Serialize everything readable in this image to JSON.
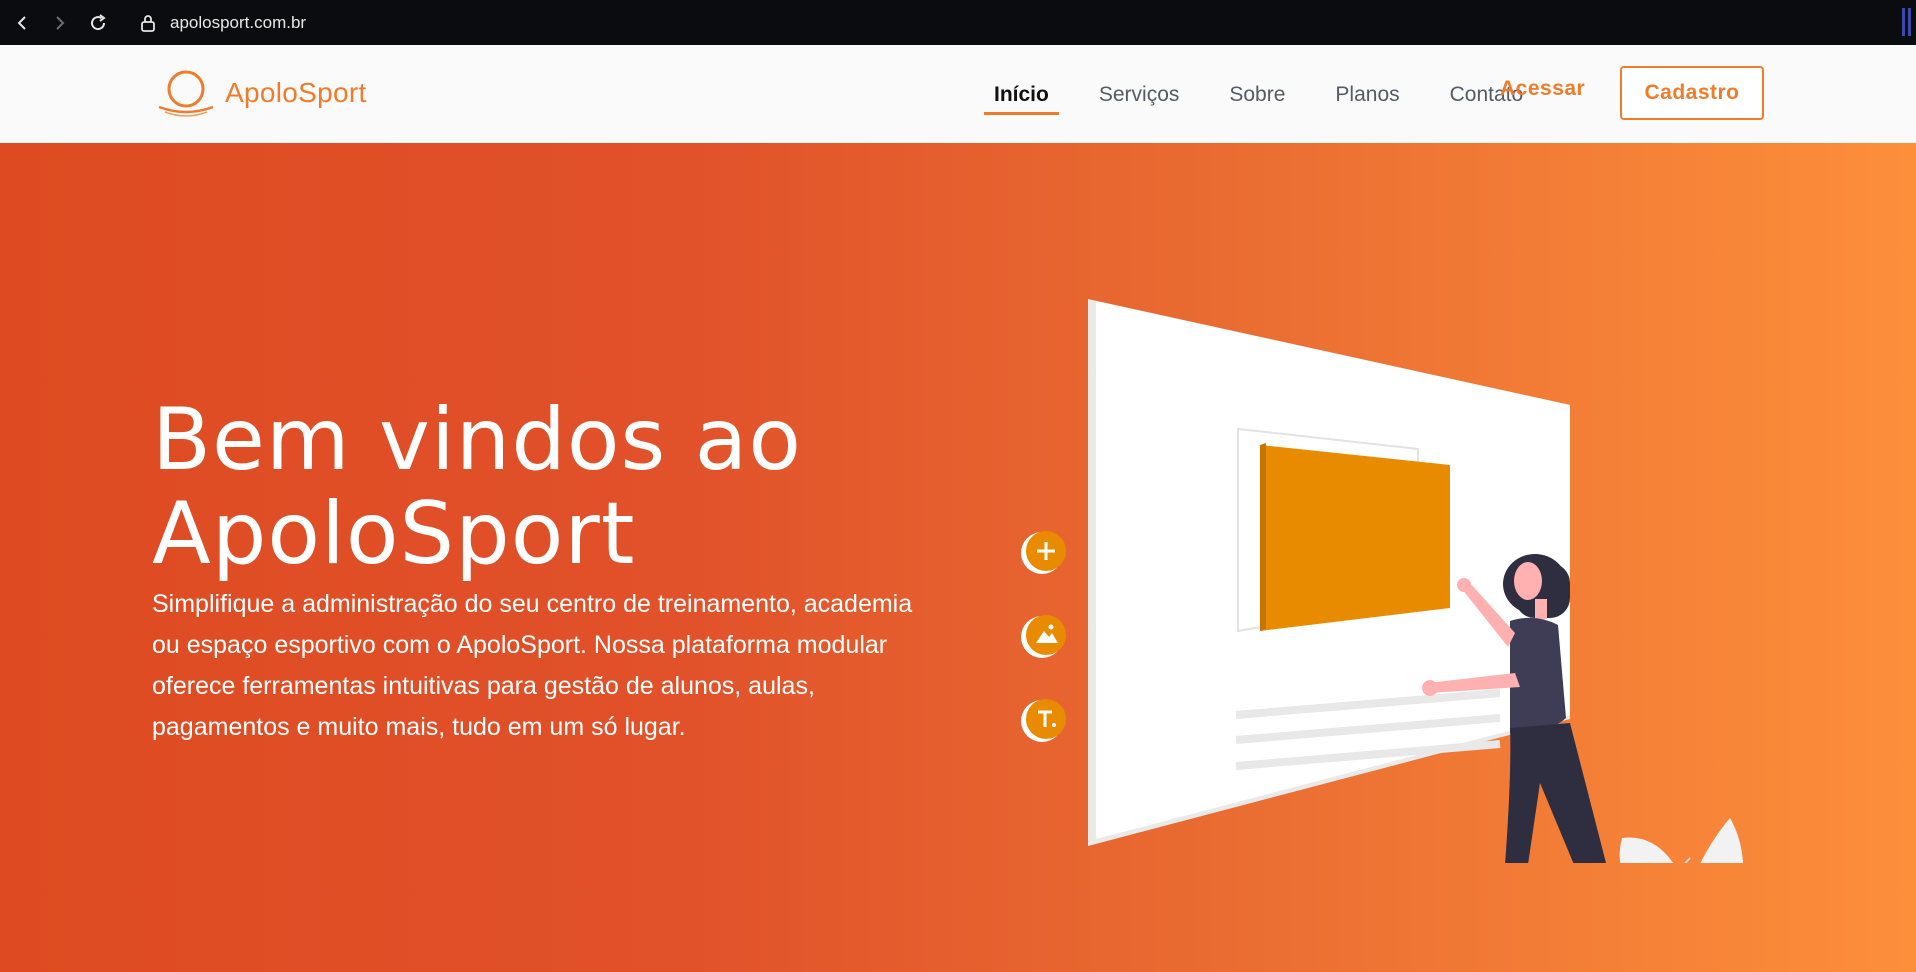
{
  "browser": {
    "url": "apolosport.com.br"
  },
  "header": {
    "logo_text": "ApoloSport",
    "nav": [
      {
        "label": "Início",
        "active": true
      },
      {
        "label": "Serviços",
        "active": false
      },
      {
        "label": "Sobre",
        "active": false
      },
      {
        "label": "Planos",
        "active": false
      },
      {
        "label": "Contato",
        "active": false
      }
    ],
    "login_label": "Acessar",
    "signup_label": "Cadastro"
  },
  "hero": {
    "title_line1": "Bem vindos ao",
    "title_line2": "ApoloSport",
    "description": "Simplifique a administração do seu centro de treinamento, academia ou espaço esportivo com o ApoloSport. Nossa plataforma modular oferece ferramentas intuitivas para gestão de alunos, aulas, pagamentos e muito mais, tudo em um só lugar."
  },
  "colors": {
    "accent": "#ef7b2b",
    "hero_gradient_start": "#de4b22",
    "hero_gradient_end": "#fd8f3b",
    "illustration_box": "#e98b00",
    "figure_dark": "#2f2e41"
  },
  "icons": [
    "back-arrow-icon",
    "forward-arrow-icon",
    "reload-icon",
    "lock-icon",
    "logo-icon",
    "add-icon",
    "image-icon",
    "text-icon"
  ]
}
